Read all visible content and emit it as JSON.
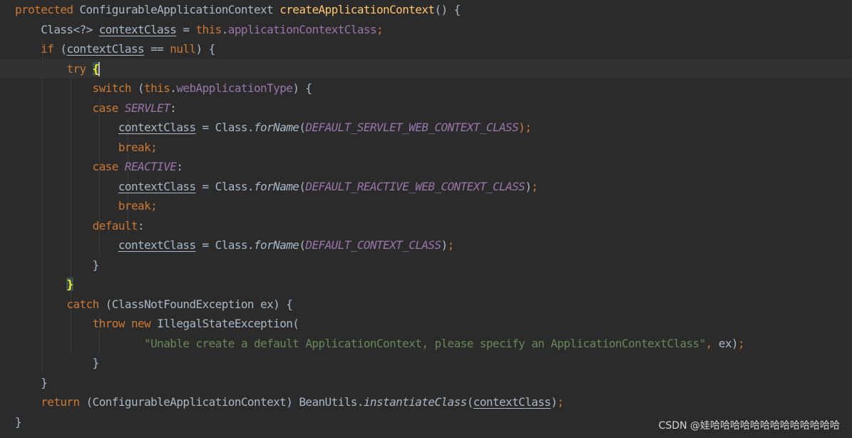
{
  "editor": {
    "lines": [
      [
        {
          "t": "protected",
          "c": "kw"
        },
        {
          "t": " ConfigurableApplicationContext "
        },
        {
          "t": "createApplicationContext",
          "c": "fn"
        },
        {
          "t": "() {"
        }
      ],
      [
        {
          "t": "    Class<?> "
        },
        {
          "t": "contextClass",
          "c": "u"
        },
        {
          "t": " = "
        },
        {
          "t": "this",
          "c": "kw"
        },
        {
          "t": "."
        },
        {
          "t": "applicationContextClass",
          "c": "fld"
        },
        {
          "t": ";",
          "c": "kw"
        }
      ],
      [
        {
          "t": "    "
        },
        {
          "t": "if",
          "c": "kw"
        },
        {
          "t": " ("
        },
        {
          "t": "contextClass",
          "c": "u"
        },
        {
          "t": " == "
        },
        {
          "t": "null",
          "c": "kw"
        },
        {
          "t": ") {"
        }
      ],
      [
        {
          "t": "        "
        },
        {
          "t": "try",
          "c": "kw"
        },
        {
          "t": " "
        },
        {
          "t": "{",
          "c": "brace-hl",
          "caret": true
        }
      ],
      [
        {
          "t": "            "
        },
        {
          "t": "switch",
          "c": "kw"
        },
        {
          "t": " ("
        },
        {
          "t": "this",
          "c": "kw"
        },
        {
          "t": "."
        },
        {
          "t": "webApplicationType",
          "c": "fld"
        },
        {
          "t": ") {"
        }
      ],
      [
        {
          "t": "            "
        },
        {
          "t": "case",
          "c": "kw"
        },
        {
          "t": " "
        },
        {
          "t": "SERVLET",
          "c": "sf"
        },
        {
          "t": ":"
        }
      ],
      [
        {
          "t": "                "
        },
        {
          "t": "contextClass",
          "c": "u"
        },
        {
          "t": " = Class."
        },
        {
          "t": "forName",
          "c": "st"
        },
        {
          "t": "("
        },
        {
          "t": "DEFAULT_SERVLET_WEB_CONTEXT_CLASS",
          "c": "sf"
        },
        {
          "t": ");",
          "c": "kw"
        }
      ],
      [
        {
          "t": "                "
        },
        {
          "t": "break;",
          "c": "kw"
        }
      ],
      [
        {
          "t": "            "
        },
        {
          "t": "case",
          "c": "kw"
        },
        {
          "t": " "
        },
        {
          "t": "REACTIVE",
          "c": "sf"
        },
        {
          "t": ":"
        }
      ],
      [
        {
          "t": "                "
        },
        {
          "t": "contextClass",
          "c": "u"
        },
        {
          "t": " = Class."
        },
        {
          "t": "forName",
          "c": "st"
        },
        {
          "t": "("
        },
        {
          "t": "DEFAULT_REACTIVE_WEB_CONTEXT_CLASS",
          "c": "sf"
        },
        {
          "t": ")"
        },
        {
          "t": ";",
          "c": "kw"
        }
      ],
      [
        {
          "t": "                "
        },
        {
          "t": "break;",
          "c": "kw"
        }
      ],
      [
        {
          "t": "            "
        },
        {
          "t": "default",
          "c": "kw"
        },
        {
          "t": ":"
        }
      ],
      [
        {
          "t": "                "
        },
        {
          "t": "contextClass",
          "c": "u"
        },
        {
          "t": " = Class."
        },
        {
          "t": "forName",
          "c": "st"
        },
        {
          "t": "("
        },
        {
          "t": "DEFAULT_CONTEXT_CLASS",
          "c": "sf"
        },
        {
          "t": ")"
        },
        {
          "t": ";",
          "c": "kw"
        }
      ],
      [
        {
          "t": "            }"
        }
      ],
      [
        {
          "t": "        "
        },
        {
          "t": "}",
          "c": "brace-hl"
        }
      ],
      [
        {
          "t": "        "
        },
        {
          "t": "catch",
          "c": "kw"
        },
        {
          "t": " (ClassNotFoundException ex) {"
        }
      ],
      [
        {
          "t": "            "
        },
        {
          "t": "throw",
          "c": "kw"
        },
        {
          "t": " "
        },
        {
          "t": "new",
          "c": "kw"
        },
        {
          "t": " IllegalStateException("
        }
      ],
      [
        {
          "t": "                    "
        },
        {
          "t": "\"Unable create a default ApplicationContext, please specify an ApplicationContextClass\"",
          "c": "str"
        },
        {
          "t": ",",
          "c": "kw"
        },
        {
          "t": " ex)"
        },
        {
          "t": ";",
          "c": "kw"
        }
      ],
      [
        {
          "t": "            }"
        }
      ],
      [
        {
          "t": "    }"
        }
      ],
      [
        {
          "t": "    "
        },
        {
          "t": "return",
          "c": "kw"
        },
        {
          "t": " (ConfigurableApplicationContext) BeanUtils."
        },
        {
          "t": "instantiateClass",
          "c": "st"
        },
        {
          "t": "("
        },
        {
          "t": "contextClass",
          "c": "u"
        },
        {
          "t": ")"
        },
        {
          "t": ";",
          "c": "kw"
        }
      ],
      [
        {
          "t": "}"
        }
      ]
    ],
    "current_line": 3
  },
  "watermark": "CSDN @娃哈哈哈哈哈哈哈哈哈哈哈哈哈"
}
